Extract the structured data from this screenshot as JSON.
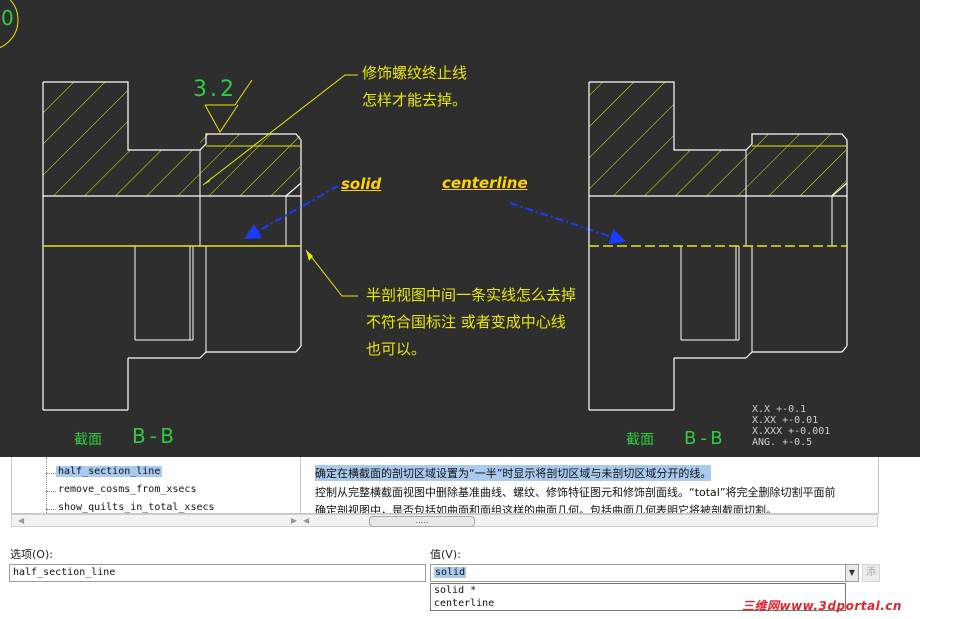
{
  "drawing": {
    "corner_mark": "0",
    "surface_finish": "3.2",
    "note_top": [
      "修饰螺纹终止线",
      "怎样才能去掉。"
    ],
    "note_bottom": [
      "半剖视图中间一条实线怎么去掉",
      "不符合国标注  或者变成中心线",
      "也可以。"
    ],
    "arrow_solid": "solid",
    "arrow_centerline": "centerline",
    "section_left": {
      "label": "截面",
      "name": "B-B"
    },
    "section_right": {
      "label": "截面",
      "name": "B-B"
    },
    "tolerances": [
      "X.X    +-0.1",
      "X.XX   +-0.01",
      "X.XXX  +-0.001",
      "ANG.   +-0.5"
    ],
    "colors": {
      "background": "#2e2e2e",
      "outline": "#ffffff",
      "hatch": "#e8e800",
      "annotation": "#2ecc40",
      "arrow": "#1a3cff"
    }
  },
  "options_tree": {
    "items": [
      "half_section_line",
      "remove_cosms_from_xsecs",
      "show_quilts_in_total_xsecs"
    ],
    "selected": "half_section_line"
  },
  "description": {
    "lines": [
      "确定在横截面的剖切区域设置为“一半”时显示将剖切区域与未剖切区域分开的线。",
      "控制从完整横截面视图中删除基准曲线、螺纹、修饰特征图元和修饰剖面线。“total”将完全删除切割平面前",
      "确定剖视图中，是否包括如曲面和面组这样的曲面几何。包括曲面几何表明它将被剖截面切割。"
    ],
    "selected_index": 0
  },
  "scrollbar": {
    "thumb_label": "....."
  },
  "option_field": {
    "label": "选项(O):",
    "value": "half_section_line"
  },
  "value_field": {
    "label": "值(V):",
    "value": "solid",
    "add_label": "添"
  },
  "dropdown": {
    "options": [
      "solid *",
      "centerline"
    ]
  },
  "watermark": "三维网www.3dportal.cn"
}
